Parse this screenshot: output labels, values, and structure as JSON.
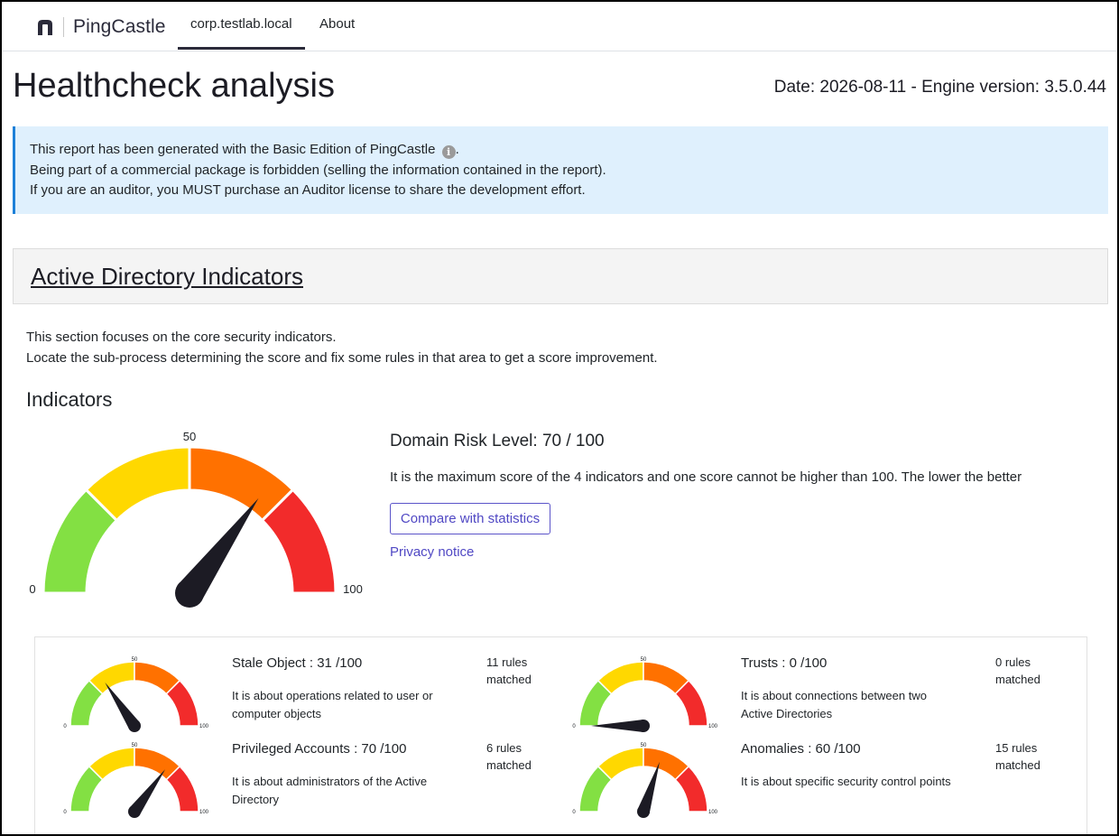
{
  "brand": {
    "name": "PingCastle"
  },
  "nav": {
    "tabs": [
      {
        "label": "corp.testlab.local",
        "active": true
      },
      {
        "label": "About",
        "active": false
      }
    ]
  },
  "header": {
    "title": "Healthcheck analysis",
    "date_line": "Date: 2026-08-11 - Engine version: 3.5.0.44"
  },
  "alert": {
    "line1": "This report has been generated with the Basic Edition of PingCastle",
    "line1_end": ".",
    "line2": "Being part of a commercial package is forbidden (selling the information contained in the report).",
    "line3": "If you are an auditor, you MUST purchase an Auditor license to share the development effort.",
    "info_glyph": "i"
  },
  "section": {
    "title": "Active Directory Indicators",
    "intro_line1": "This section focuses on the core security indicators.",
    "intro_line2": "Locate the sub-process determining the score and fix some rules in that area to get a score improvement.",
    "subheading": "Indicators"
  },
  "main_gauge": {
    "score": 70,
    "min_label": "0",
    "mid_label": "50",
    "max_label": "100",
    "colors": {
      "green": "#83e043",
      "yellow": "#ffd800",
      "orange": "#ff7100",
      "red": "#f22b2b",
      "needle": "#1c1b24"
    }
  },
  "risk": {
    "title": "Domain Risk Level: 70 / 100",
    "description": "It is the maximum score of the 4 indicators and one score cannot be higher than 100. The lower the better",
    "compare_button": "Compare with statistics",
    "privacy_link": "Privacy notice"
  },
  "indicators": [
    {
      "title": "Stale Object : 31 /100",
      "score": 31,
      "description": "It is about operations related to user or computer objects",
      "rules": "11 rules matched"
    },
    {
      "title": "Trusts : 0 /100",
      "score": 0,
      "description": "It is about connections between two Active Directories",
      "rules": "0 rules matched"
    },
    {
      "title": "Privileged Accounts : 70 /100",
      "score": 70,
      "description": "It is about administrators of the Active Directory",
      "rules": "6 rules matched"
    },
    {
      "title": "Anomalies : 60 /100",
      "score": 60,
      "description": "It is about specific security control points",
      "rules": "15 rules matched"
    }
  ],
  "mini_gauge_labels": {
    "min": "0",
    "mid": "50",
    "max": "100"
  }
}
